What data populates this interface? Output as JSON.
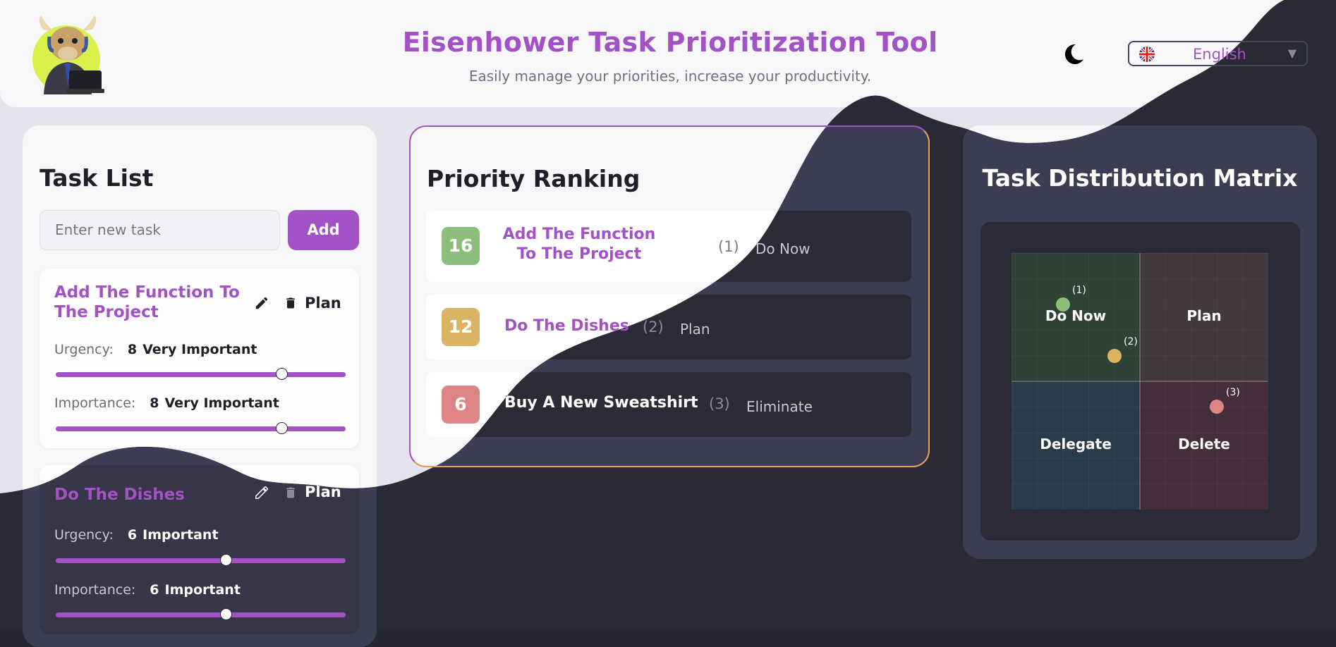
{
  "header": {
    "title": "Eisenhower Task Prioritization Tool",
    "subtitle": "Easily manage your priorities, increase your productivity.",
    "language": "English",
    "theme_icon": "moon-icon",
    "logo_icon": "bull-mascot-logo"
  },
  "task_list": {
    "heading": "Task List",
    "input_placeholder": "Enter new task",
    "add_label": "Add",
    "urgency_label": "Urgency:",
    "importance_label": "Importance:",
    "tasks": [
      {
        "name": "Add The Function To The Project",
        "quadrant": "Plan",
        "urgency": "8",
        "urgency_desc": "Very Important",
        "urgency_fraction": 0.78,
        "importance": "8",
        "importance_desc": "Very Important",
        "importance_fraction": 0.78
      },
      {
        "name": "Do The Dishes",
        "quadrant": "Plan",
        "urgency": "6",
        "urgency_desc": "Important",
        "urgency_fraction": 0.59,
        "importance": "6",
        "importance_desc": "Important",
        "importance_fraction": 0.59
      }
    ]
  },
  "ranking": {
    "heading": "Priority Ranking",
    "items": [
      {
        "score": "16",
        "name": "Add The Function To The Project",
        "num": "(1)",
        "category": "Do Now",
        "color": "#8bbd7c"
      },
      {
        "score": "12",
        "name": "Do The Dishes",
        "num": "(2)",
        "category": "Plan",
        "color": "#d9b463"
      },
      {
        "score": "6",
        "name": "Buy A New Sweatshirt",
        "num": "(3)",
        "category": "Eliminate",
        "color": "#dd8585"
      }
    ]
  },
  "matrix": {
    "heading": "Task Distribution Matrix",
    "quadrants": [
      "Do Now",
      "Plan",
      "Delegate",
      "Delete"
    ],
    "points": [
      "(1)",
      "(2)",
      "(3)"
    ]
  },
  "colors": {
    "accent": "#a352c6",
    "do_now": "#8bbd7c",
    "plan": "#d9b463",
    "delete": "#dd8585",
    "border_warm": "#e1a35a"
  }
}
